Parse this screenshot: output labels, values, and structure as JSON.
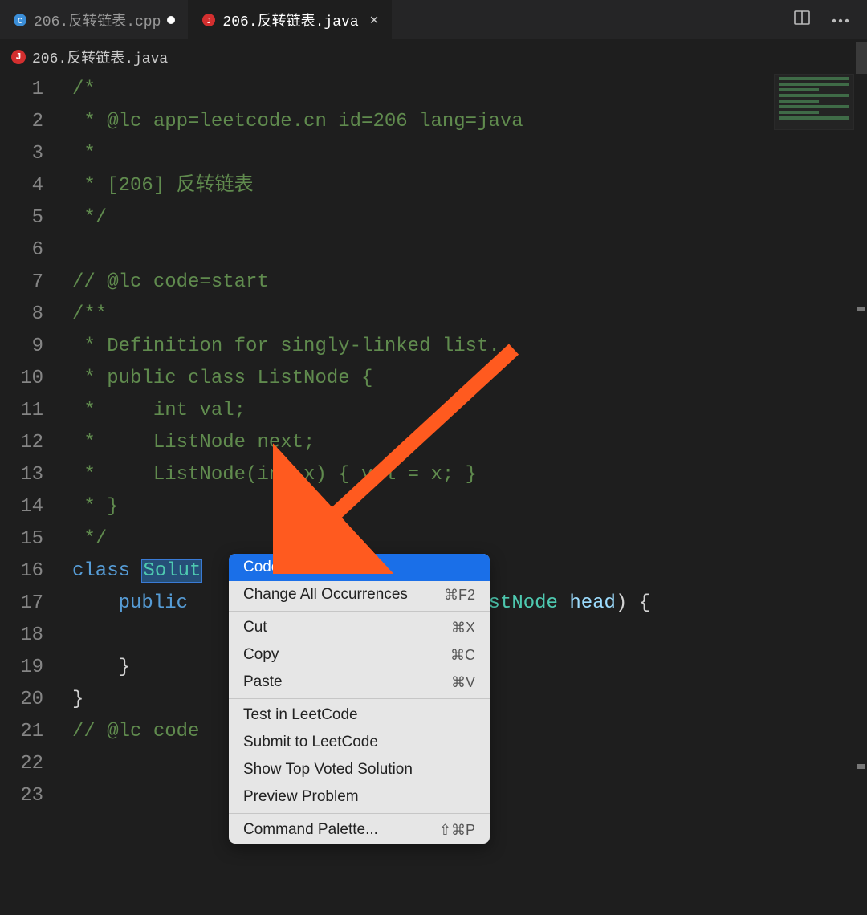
{
  "tabs": {
    "inactive": {
      "label": "206.反转链表.cpp",
      "icon": "cpp"
    },
    "active": {
      "label": "206.反转链表.java",
      "icon": "java"
    }
  },
  "breadcrumb": {
    "file": "206.反转链表.java",
    "status": "error"
  },
  "code": {
    "lines": [
      {
        "n": "1",
        "segs": [
          {
            "t": "/*",
            "c": "tok-comment"
          }
        ]
      },
      {
        "n": "2",
        "segs": [
          {
            "t": " * @lc app=leetcode.cn id=206 lang=java",
            "c": "tok-comment"
          }
        ]
      },
      {
        "n": "3",
        "segs": [
          {
            "t": " *",
            "c": "tok-comment"
          }
        ]
      },
      {
        "n": "4",
        "segs": [
          {
            "t": " * [206] 反转链表",
            "c": "tok-comment"
          }
        ]
      },
      {
        "n": "5",
        "segs": [
          {
            "t": " */",
            "c": "tok-comment"
          }
        ]
      },
      {
        "n": "6",
        "segs": [
          {
            "t": "",
            "c": ""
          }
        ]
      },
      {
        "n": "7",
        "segs": [
          {
            "t": "// @lc code=start",
            "c": "tok-comment"
          }
        ]
      },
      {
        "n": "8",
        "segs": [
          {
            "t": "/**",
            "c": "tok-comment"
          }
        ]
      },
      {
        "n": "9",
        "segs": [
          {
            "t": " * Definition for singly-linked list.",
            "c": "tok-comment"
          }
        ]
      },
      {
        "n": "10",
        "segs": [
          {
            "t": " * public class ListNode {",
            "c": "tok-comment"
          }
        ]
      },
      {
        "n": "11",
        "segs": [
          {
            "t": " *     int val;",
            "c": "tok-comment"
          }
        ]
      },
      {
        "n": "12",
        "segs": [
          {
            "t": " *     ListNode next;",
            "c": "tok-comment"
          }
        ]
      },
      {
        "n": "13",
        "segs": [
          {
            "t": " *     ListNode(int x) { val = x; }",
            "c": "tok-comment"
          }
        ]
      },
      {
        "n": "14",
        "segs": [
          {
            "t": " * }",
            "c": "tok-comment"
          }
        ]
      },
      {
        "n": "15",
        "segs": [
          {
            "t": " */",
            "c": "tok-comment"
          }
        ]
      },
      {
        "n": "16",
        "segs": [
          {
            "t": "class ",
            "c": "tok-keyword"
          },
          {
            "t": "Solut",
            "c": "tok-type selected"
          }
        ]
      },
      {
        "n": "17",
        "segs": [
          {
            "t": "    public ",
            "c": "tok-keyword"
          },
          {
            "t": "                       ",
            "c": ""
          },
          {
            "t": "ListNode",
            "c": "tok-type"
          },
          {
            "t": " ",
            "c": ""
          },
          {
            "t": "head",
            "c": "tok-var"
          },
          {
            "t": ") {",
            "c": "tok-punc"
          }
        ]
      },
      {
        "n": "18",
        "segs": [
          {
            "t": "",
            "c": ""
          }
        ]
      },
      {
        "n": "19",
        "segs": [
          {
            "t": "    }",
            "c": "tok-punc"
          }
        ]
      },
      {
        "n": "20",
        "segs": [
          {
            "t": "}",
            "c": "tok-punc"
          }
        ]
      },
      {
        "n": "21",
        "segs": [
          {
            "t": "// @lc code",
            "c": "tok-comment"
          }
        ]
      },
      {
        "n": "22",
        "segs": [
          {
            "t": "",
            "c": ""
          }
        ]
      },
      {
        "n": "23",
        "segs": [
          {
            "t": "",
            "c": ""
          }
        ]
      }
    ]
  },
  "contextMenu": {
    "items": [
      {
        "label": "Codelf",
        "shortcut": "",
        "highlight": true
      },
      {
        "label": "Change All Occurrences",
        "shortcut": "⌘F2"
      },
      {
        "sep": true
      },
      {
        "label": "Cut",
        "shortcut": "⌘X"
      },
      {
        "label": "Copy",
        "shortcut": "⌘C"
      },
      {
        "label": "Paste",
        "shortcut": "⌘V"
      },
      {
        "sep": true
      },
      {
        "label": "Test in LeetCode",
        "shortcut": ""
      },
      {
        "label": "Submit to LeetCode",
        "shortcut": ""
      },
      {
        "label": "Show Top Voted Solution",
        "shortcut": ""
      },
      {
        "label": "Preview Problem",
        "shortcut": ""
      },
      {
        "sep": true
      },
      {
        "label": "Command Palette...",
        "shortcut": "⇧⌘P"
      }
    ]
  },
  "annotation": {
    "arrowColor": "#ff5a1f"
  }
}
